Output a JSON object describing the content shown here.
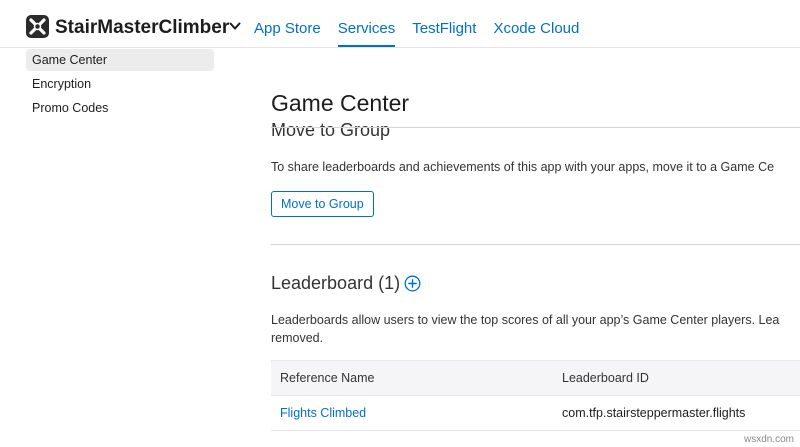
{
  "header": {
    "app_name": "StairMasterClimber",
    "nav": [
      {
        "label": "App Store",
        "active": false
      },
      {
        "label": "Services",
        "active": true
      },
      {
        "label": "TestFlight",
        "active": false
      },
      {
        "label": "Xcode Cloud",
        "active": false
      }
    ]
  },
  "sidebar": {
    "items": [
      {
        "label": "Game Center",
        "selected": true
      },
      {
        "label": "Encryption",
        "selected": false
      },
      {
        "label": "Promo Codes",
        "selected": false
      }
    ]
  },
  "main": {
    "title": "Game Center",
    "move_group": {
      "heading": "Move to Group",
      "description": "To share leaderboards and achievements of this app with your apps, move it to a Game Ce",
      "button_label": "Move to Group"
    },
    "leaderboard": {
      "heading": "Leaderboard (1)",
      "description_line1": "Leaderboards allow users to view the top scores of all your app’s Game Center players. Lea",
      "description_line2": "removed.",
      "columns": [
        "Reference Name",
        "Leaderboard ID"
      ],
      "rows": [
        {
          "reference_name": "Flights Climbed",
          "leaderboard_id": "com.tfp.stairsteppermaster.flights"
        }
      ]
    }
  },
  "watermark": "wsxdn.com",
  "colors": {
    "accent": "#0070c9",
    "text": "#1d1d1f",
    "table_header_bg": "#f5f5f7"
  }
}
